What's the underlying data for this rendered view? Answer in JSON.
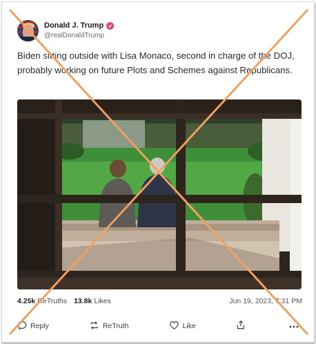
{
  "post": {
    "author": {
      "display_name": "Donald J. Trump",
      "handle": "@realDonaldTrump",
      "verified": true
    },
    "text": "Biden sitting outside with Lisa Monaco, second in charge of the DOJ, probably working on future Plots and Schemes against Republicans.",
    "image": {
      "description_icon": "photo"
    },
    "stats": {
      "retruths_count": "4.25k",
      "retruths_label": "ReTruths",
      "likes_count": "13.8k",
      "likes_label": "Likes",
      "timestamp": "Jun 19, 2023, 7:31 PM"
    },
    "actions": {
      "reply": "Reply",
      "retruth": "ReTruth",
      "like": "Like"
    }
  },
  "colors": {
    "verified_badge": "#e0457b",
    "overlay_cross": "#f0a060"
  }
}
